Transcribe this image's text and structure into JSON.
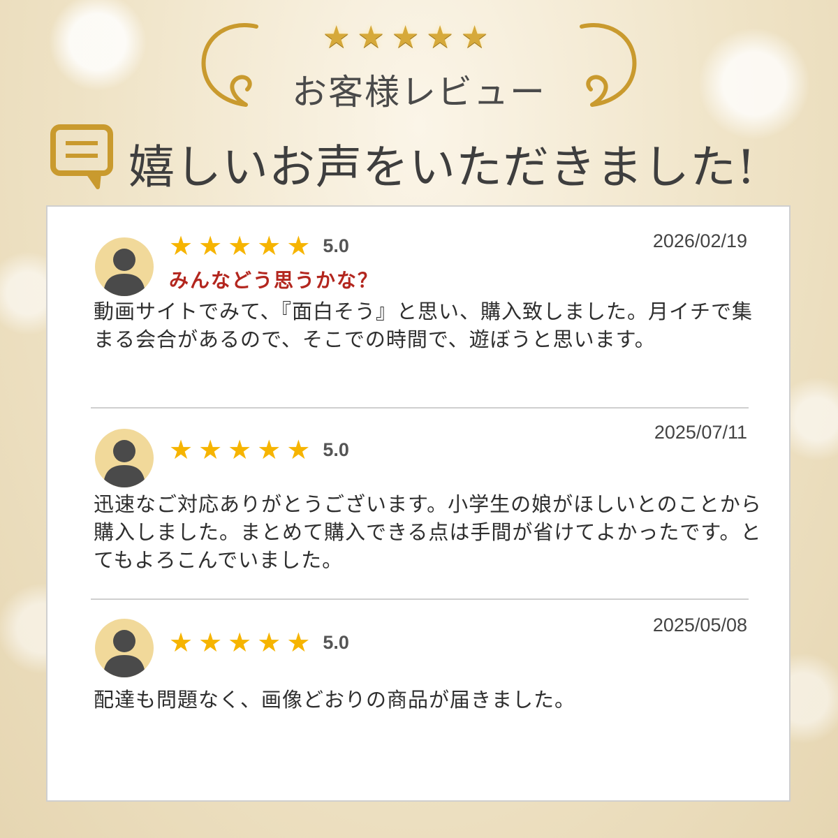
{
  "header": {
    "star_count": 5,
    "subtitle": "お客様レビュー",
    "title": "嬉しいお声をいただきました!",
    "icon": "chat-bubble-icon"
  },
  "reviews": [
    {
      "rating_stars": 5,
      "score": "5.0",
      "date": "2026/02/19",
      "headline": "みんなどう思うかな？",
      "body": "動画サイトでみて、『面白そう』と思い、購入致しました。月イチで集まる会合があるので、そこでの時間で、遊ぼうと思います。"
    },
    {
      "rating_stars": 5,
      "score": "5.0",
      "date": "2025/07/11",
      "headline": "",
      "body": "迅速なご対応ありがとうございます。小学生の娘がほしいとのことから購入しました。まとめて購入できる点は手間が省けてよかったです。とてもよろこんでいました。"
    },
    {
      "rating_stars": 5,
      "score": "5.0",
      "date": "2025/05/08",
      "headline": "",
      "body": "配達も問題なく、画像どおりの商品が届きました。"
    }
  ],
  "colors": {
    "gold": "#d6a93a",
    "star": "#f6b400",
    "headline": "#b3261e",
    "avatar_bg": "#f1d99a",
    "avatar_fg": "#4a4a4a"
  }
}
